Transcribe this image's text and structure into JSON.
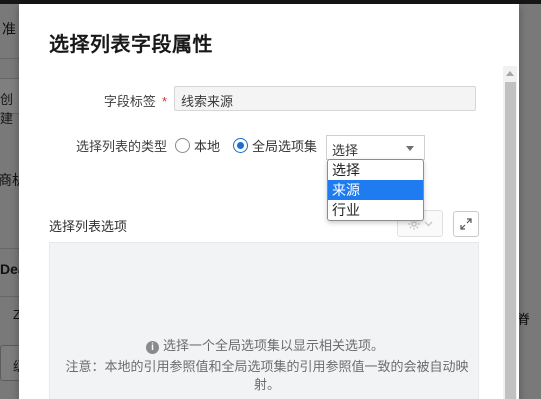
{
  "background_page": {
    "fragments": [
      "准",
      "创建",
      "商机",
      "Dea",
      "Z",
      "级",
      "脊"
    ]
  },
  "dialog": {
    "title": "选择列表字段属性",
    "field_label": {
      "label": "字段标签",
      "required_mark": "*",
      "value": "线索来源"
    },
    "list_type": {
      "label": "选择列表的类型",
      "options": [
        "本地",
        "全局选项集"
      ],
      "selected": "全局选项集"
    },
    "global_set_select": {
      "value": "选择",
      "options": [
        "选择",
        "来源",
        "行业"
      ],
      "highlighted": "来源"
    },
    "options_section": {
      "label": "选择列表选项",
      "empty_message": "选择一个全局选项集以显示相关选项。",
      "note": "注意：本地的引用参照值和全局选项集的引用参照值一致的会被自动映射。"
    }
  },
  "icons": {
    "info": "info-icon",
    "gear": "gear-icon",
    "expand": "expand-icon",
    "caret": "caret-down-icon"
  },
  "colors": {
    "accent": "#1e7bf0",
    "required": "#d9331f"
  }
}
